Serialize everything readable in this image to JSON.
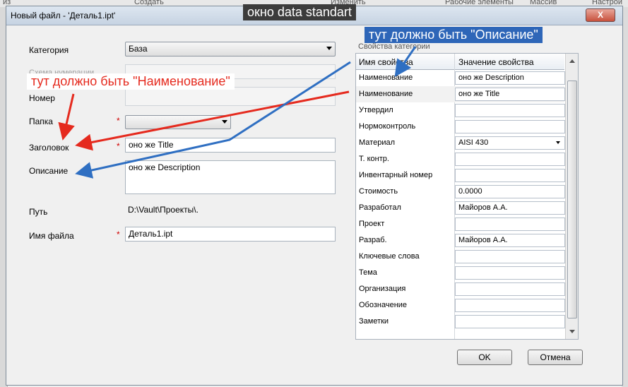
{
  "background": {
    "tab_left": "из",
    "tab_create": "Создать",
    "tab_change": "Изменить",
    "tab_work": "Рабочие элементы",
    "tab_array": "Массив",
    "tab_setup": "Настрой"
  },
  "dialog": {
    "title": "Новый файл - 'Деталь1.ipt'",
    "close": "X"
  },
  "form": {
    "category_label": "Категория",
    "category_value": "База",
    "numbering_label": "Схема нумерации",
    "number_label": "Номер",
    "folder_label": "Папка",
    "title_label": "Заголовок",
    "title_value": "оно же Title",
    "description_label": "Описание",
    "description_value": "оно же Description",
    "path_label": "Путь",
    "path_value": "D:\\Vault\\Проекты\\.",
    "filename_label": "Имя файла",
    "filename_value": "Деталь1.ipt",
    "required_mark": "*"
  },
  "properties": {
    "group_label": "Свойства категории",
    "col_name": "Имя свойства",
    "col_value": "Значение свойства",
    "rows": [
      {
        "name": "Наименование",
        "value": "оно же Description"
      },
      {
        "name": "Наименование",
        "value": "оно же Title"
      },
      {
        "name": "Утвердил",
        "value": ""
      },
      {
        "name": "Нормоконтроль",
        "value": ""
      },
      {
        "name": "Материал",
        "value": "AISI 430"
      },
      {
        "name": "Т. контр.",
        "value": ""
      },
      {
        "name": "Инвентарный номер",
        "value": ""
      },
      {
        "name": "Стоимость",
        "value": "0.0000"
      },
      {
        "name": "Разработал",
        "value": "Майоров А.А."
      },
      {
        "name": "Проект",
        "value": ""
      },
      {
        "name": "Разраб.",
        "value": "Майоров А.А."
      },
      {
        "name": "Ключевые слова",
        "value": ""
      },
      {
        "name": "Тема",
        "value": ""
      },
      {
        "name": "Организация",
        "value": ""
      },
      {
        "name": "Обозначение",
        "value": ""
      },
      {
        "name": "Заметки",
        "value": ""
      }
    ]
  },
  "buttons": {
    "ok": "OK",
    "cancel": "Отмена"
  },
  "annotations": {
    "window_note": "окно data standart",
    "name_note": "тут должно быть \"Наименование\"",
    "desc_note": "тут должно быть \"Описание\""
  },
  "colors": {
    "annot_red": "#e52a1e",
    "annot_blue": "#2f6fc2"
  }
}
